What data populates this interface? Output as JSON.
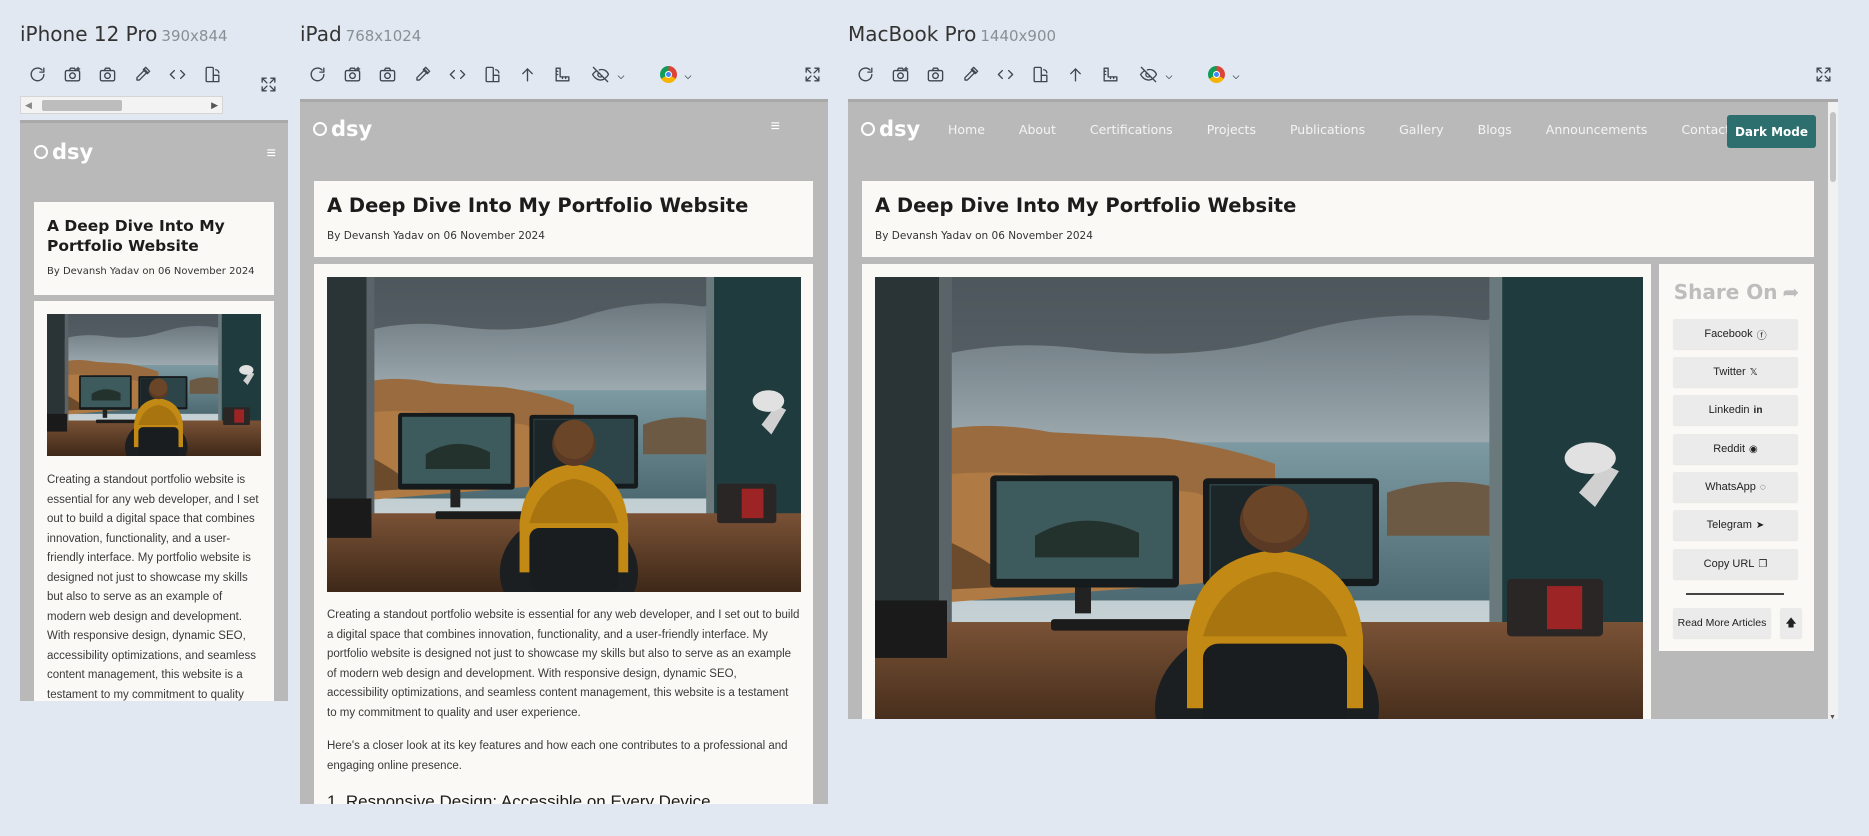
{
  "devices": {
    "iphone": {
      "name": "iPhone 12 Pro",
      "resolution": "390x844"
    },
    "ipad": {
      "name": "iPad",
      "resolution": "768x1024"
    },
    "macbook": {
      "name": "MacBook Pro",
      "resolution": "1440x900"
    }
  },
  "site": {
    "logo": "dsy",
    "nav": [
      "Home",
      "About",
      "Certifications",
      "Projects",
      "Publications",
      "Gallery",
      "Blogs",
      "Announcements",
      "Contact"
    ],
    "dark_mode_label": "Dark Mode"
  },
  "post": {
    "title": "A Deep Dive Into My Portfolio Website",
    "byline": "By Devansh Yadav on 06 November 2024",
    "paragraph1": "Creating a standout portfolio website is essential for any web developer, and I set out to build a digital space that combines innovation, functionality, and a user-friendly interface. My portfolio website is designed not just to showcase my skills but also to serve as an example of modern web design and development. With responsive design, dynamic SEO, accessibility optimizations, and seamless content management, this website is a testament to my commitment to quality and user experience.",
    "paragraph2": "Here's a closer look at its key features and how each one contributes to a professional and engaging online presence.",
    "heading1": "1. Responsive Design: Accessible on Every Device"
  },
  "share": {
    "title": "Share On",
    "buttons": [
      {
        "label": "Facebook",
        "icon": "facebook-icon",
        "glyph": "ⓕ"
      },
      {
        "label": "Twitter",
        "icon": "x-icon",
        "glyph": "𝕏"
      },
      {
        "label": "Linkedin",
        "icon": "linkedin-icon",
        "glyph": "in"
      },
      {
        "label": "Reddit",
        "icon": "reddit-icon",
        "glyph": "◉"
      },
      {
        "label": "WhatsApp",
        "icon": "whatsapp-icon",
        "glyph": "◌"
      },
      {
        "label": "Telegram",
        "icon": "telegram-icon",
        "glyph": "➤"
      },
      {
        "label": "Copy URL",
        "icon": "copy-icon",
        "glyph": "❐"
      }
    ],
    "read_more": "Read More Articles",
    "top_glyph": "🡅"
  },
  "colors": {
    "page_bg": "#e1e8f1",
    "site_bg": "#b9b9b9",
    "card_bg": "#faf9f5",
    "accent": "#2d6e6e"
  }
}
